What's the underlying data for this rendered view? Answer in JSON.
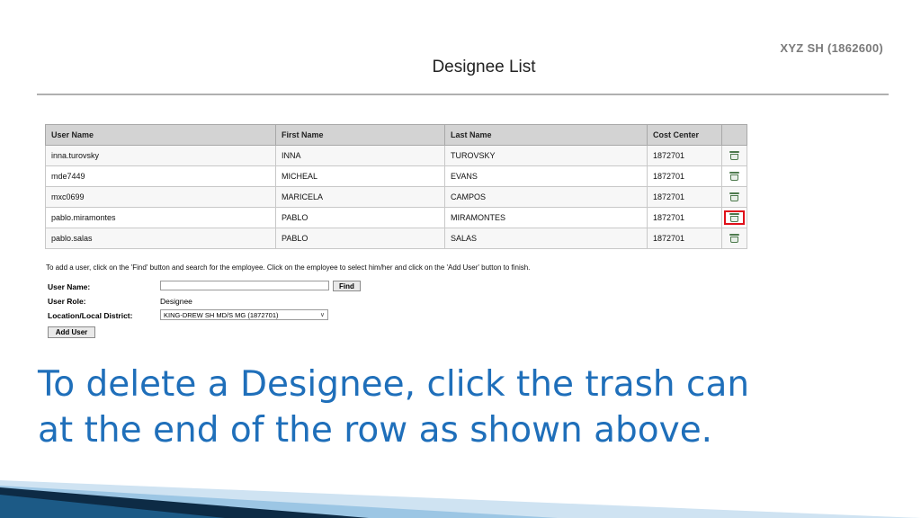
{
  "site_label": "XYZ SH (1862600)",
  "page_title": "Designee List",
  "table": {
    "columns": [
      "User Name",
      "First Name",
      "Last Name",
      "Cost Center",
      ""
    ],
    "rows": [
      {
        "user_name": "inna.turovsky",
        "first_name": "INNA",
        "last_name": "TUROVSKY",
        "cost_center": "1872701",
        "highlighted": false
      },
      {
        "user_name": "mde7449",
        "first_name": "MICHEAL",
        "last_name": "EVANS",
        "cost_center": "1872701",
        "highlighted": false
      },
      {
        "user_name": "mxc0699",
        "first_name": "MARICELA",
        "last_name": "CAMPOS",
        "cost_center": "1872701",
        "highlighted": false
      },
      {
        "user_name": "pablo.miramontes",
        "first_name": "PABLO",
        "last_name": "MIRAMONTES",
        "cost_center": "1872701",
        "highlighted": true
      },
      {
        "user_name": "pablo.salas",
        "first_name": "PABLO",
        "last_name": "SALAS",
        "cost_center": "1872701",
        "highlighted": false
      }
    ],
    "row_icon": "trash-can-icon"
  },
  "instructions": "To add a user, click on the 'Find' button and search for the employee. Click on the employee to select him/her and click on the 'Add User' button to finish.",
  "form": {
    "user_name_label": "User Name:",
    "user_name_value": "",
    "find_label": "Find",
    "user_role_label": "User Role:",
    "user_role_value": "Designee",
    "location_label": "Location/Local District:",
    "location_value": "KING-DREW SH MD/S MG (1872701)",
    "add_user_label": "Add User"
  },
  "caption": {
    "line1": "To delete a Designee, click the trash can",
    "line2": "at the end of the row as shown above."
  },
  "colors": {
    "caption": "#1f6fba",
    "highlight": "#e0101a",
    "decoration_dark": "#0d2b45",
    "decoration_light": "#9cc6e4"
  }
}
